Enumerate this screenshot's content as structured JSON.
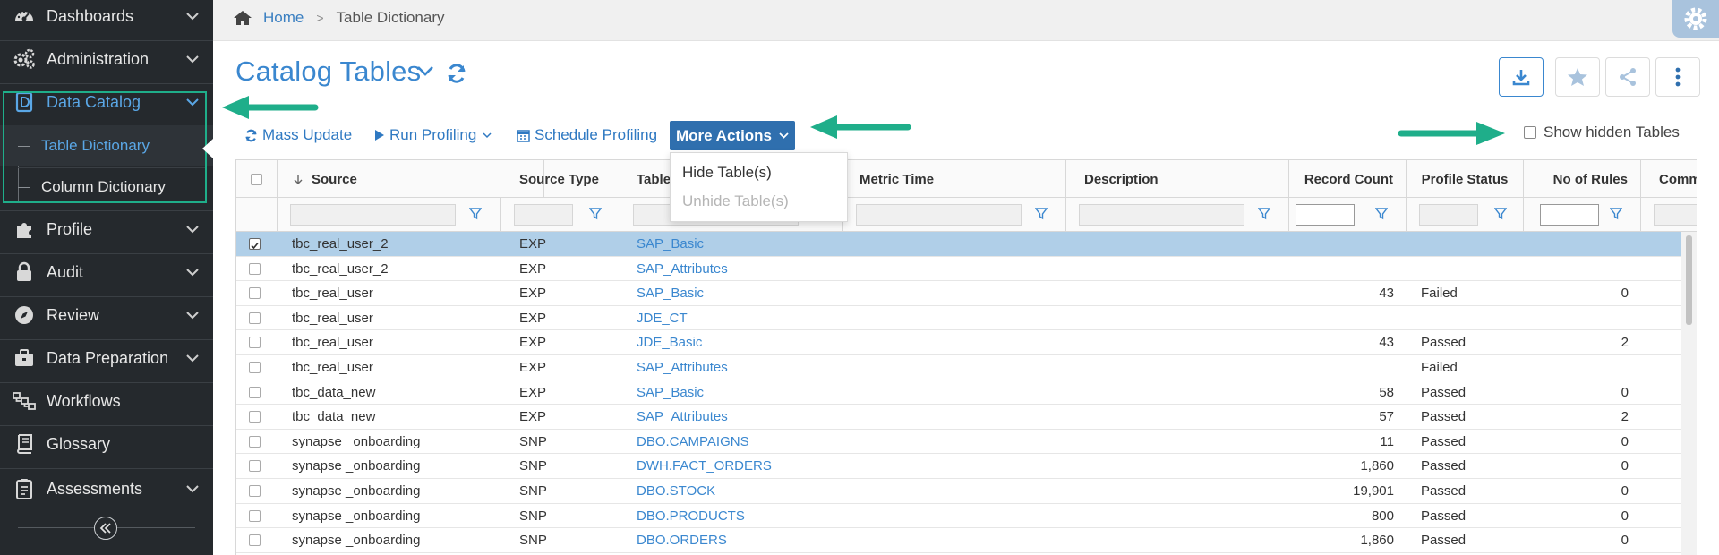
{
  "sidebar": {
    "items": [
      {
        "label": "Dashboards",
        "icon": "speedometer-icon",
        "chevron": true
      },
      {
        "label": "Administration",
        "icon": "gears-icon",
        "chevron": true
      },
      {
        "label": "Data Catalog",
        "icon": "catalog-d-icon",
        "chevron": true,
        "active": true
      },
      {
        "label": "Profile",
        "icon": "puzzle-icon",
        "chevron": true
      },
      {
        "label": "Audit",
        "icon": "lock-icon",
        "chevron": true
      },
      {
        "label": "Review",
        "icon": "compass-icon",
        "chevron": true
      },
      {
        "label": "Data Preparation",
        "icon": "briefcase-icon",
        "chevron": true
      },
      {
        "label": "Workflows",
        "icon": "workflow-icon",
        "chevron": false
      },
      {
        "label": "Glossary",
        "icon": "book-icon",
        "chevron": false
      },
      {
        "label": "Assessments",
        "icon": "clipboard-icon",
        "chevron": true
      }
    ],
    "sub_items": [
      {
        "label": "Table Dictionary",
        "active": true
      },
      {
        "label": "Column Dictionary",
        "active": false
      }
    ],
    "collapse_icon": "double-chevron-left-icon"
  },
  "breadcrumb": {
    "home": "Home",
    "current": "Table Dictionary"
  },
  "page": {
    "title": "Catalog Tables"
  },
  "toolbar": {
    "mass_update": "Mass Update",
    "run_profiling": "Run Profiling",
    "schedule_profiling": "Schedule Profiling",
    "more_actions": "More Actions",
    "show_hidden": "Show hidden Tables"
  },
  "more_actions_menu": {
    "hide": "Hide Table(s)",
    "unhide": "Unhide Table(s)"
  },
  "grid": {
    "columns": {
      "source": "Source",
      "source_type": "Source Type",
      "table": "Table",
      "metric_time": "Metric Time",
      "description": "Description",
      "record_count": "Record Count",
      "profile_status": "Profile Status",
      "no_of_rules": "No of Rules",
      "comm": "Comm"
    },
    "rows": [
      {
        "source": "tbc_real_user_2",
        "type": "EXP",
        "table": "SAP_Basic",
        "count": "",
        "status": "",
        "rules": "",
        "selected": true
      },
      {
        "source": "tbc_real_user_2",
        "type": "EXP",
        "table": "SAP_Attributes",
        "count": "",
        "status": "",
        "rules": ""
      },
      {
        "source": "tbc_real_user",
        "type": "EXP",
        "table": "SAP_Basic",
        "count": "43",
        "status": "Failed",
        "rules": "0"
      },
      {
        "source": "tbc_real_user",
        "type": "EXP",
        "table": "JDE_CT",
        "count": "",
        "status": "",
        "rules": ""
      },
      {
        "source": "tbc_real_user",
        "type": "EXP",
        "table": "JDE_Basic",
        "count": "43",
        "status": "Passed",
        "rules": "2"
      },
      {
        "source": "tbc_real_user",
        "type": "EXP",
        "table": "SAP_Attributes",
        "count": "",
        "status": "Failed",
        "rules": ""
      },
      {
        "source": "tbc_data_new",
        "type": "EXP",
        "table": "SAP_Basic",
        "count": "58",
        "status": "Passed",
        "rules": "0"
      },
      {
        "source": "tbc_data_new",
        "type": "EXP",
        "table": "SAP_Attributes",
        "count": "57",
        "status": "Passed",
        "rules": "2"
      },
      {
        "source": "synapse _onboarding",
        "type": "SNP",
        "table": "DBO.CAMPAIGNS",
        "count": "11",
        "status": "Passed",
        "rules": "0"
      },
      {
        "source": "synapse _onboarding",
        "type": "SNP",
        "table": "DWH.FACT_ORDERS",
        "count": "1,860",
        "status": "Passed",
        "rules": "0"
      },
      {
        "source": "synapse _onboarding",
        "type": "SNP",
        "table": "DBO.STOCK",
        "count": "19,901",
        "status": "Passed",
        "rules": "0"
      },
      {
        "source": "synapse _onboarding",
        "type": "SNP",
        "table": "DBO.PRODUCTS",
        "count": "800",
        "status": "Passed",
        "rules": "0"
      },
      {
        "source": "synapse _onboarding",
        "type": "SNP",
        "table": "DBO.ORDERS",
        "count": "1,860",
        "status": "Passed",
        "rules": "0"
      }
    ]
  },
  "colors": {
    "sidebar_bg": "#25292d",
    "accent": "#3a87cf",
    "primary_button": "#2f6fae",
    "selected_row": "#b0cfe8",
    "annotation_arrow": "#1fae8a"
  }
}
